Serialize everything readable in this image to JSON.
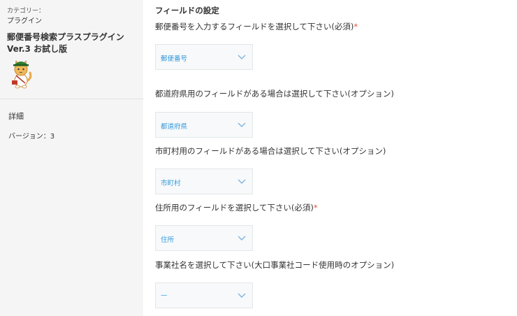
{
  "sidebar": {
    "category_label": "カテゴリー：",
    "category_value": "プラグイン",
    "plugin_name_line1": "郵便番号検索プラスプラグイン",
    "plugin_name_line2": "Ver.3 お試し版",
    "detail_link": "詳細",
    "version": "バージョン：3"
  },
  "main": {
    "section_title": "フィールドの設定",
    "fields": [
      {
        "label": "郵便番号を入力するフィールドを選択して下さい(必須)",
        "required_mark": "*",
        "selected": "郵便番号"
      },
      {
        "label": "都道府県用のフィールドがある場合は選択して下さい(オプション)",
        "selected": "都道府県"
      },
      {
        "label": "市町村用のフィールドがある場合は選択して下さい(オプション)",
        "selected": "市町村"
      },
      {
        "label": "住所用のフィールドを選択して下さい(必須)",
        "required_mark": "*",
        "selected": "住所"
      },
      {
        "label": "事業社名を選択して下さい(大口事業社コード使用時のオプション)",
        "selected": "—"
      }
    ]
  },
  "colors": {
    "accent": "#3498db",
    "required": "#e74c3c",
    "sidebar_bg": "#f5f5f5",
    "select_bg": "#f7f9fa"
  },
  "icons": [
    "mascot-cat-icon",
    "chevron-down-icon"
  ]
}
